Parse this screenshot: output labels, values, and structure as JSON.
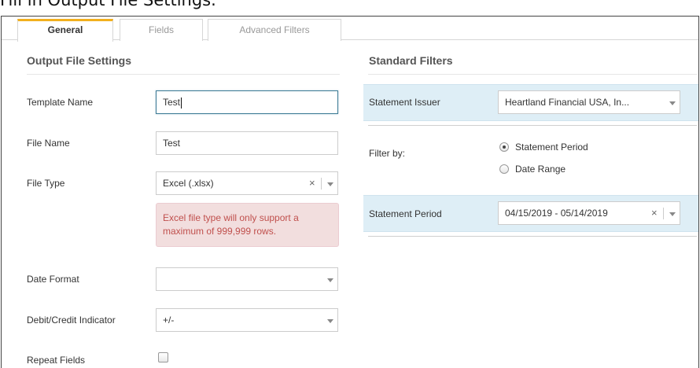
{
  "caption": "Fill in Output File Settings.",
  "tabs": {
    "general": "General",
    "fields": "Fields",
    "advanced_filters": "Advanced Filters"
  },
  "output_settings": {
    "title": "Output File Settings",
    "template_name": {
      "label": "Template Name",
      "value": "Test"
    },
    "file_name": {
      "label": "File Name",
      "value": "Test"
    },
    "file_type": {
      "label": "File Type",
      "value": "Excel (.xlsx)"
    },
    "file_type_warning": "Excel file type will only support a maximum of 999,999 rows.",
    "date_format": {
      "label": "Date Format",
      "value": ""
    },
    "debit_credit": {
      "label": "Debit/Credit Indicator",
      "value": "+/-"
    },
    "repeat_fields": {
      "label": "Repeat Fields",
      "checked": false
    }
  },
  "standard_filters": {
    "title": "Standard Filters",
    "statement_issuer": {
      "label": "Statement Issuer",
      "value": "Heartland Financial USA, In..."
    },
    "filter_by": {
      "label": "Filter by:",
      "options": [
        "Statement Period",
        "Date Range"
      ],
      "selected": "Statement Period"
    },
    "statement_period": {
      "label": "Statement Period",
      "value": "04/15/2019 - 05/14/2019"
    }
  },
  "icons": {
    "clear": "×",
    "dropdown": "chevron-down-icon"
  },
  "colors": {
    "active_tab_accent": "#f2b01e",
    "filter_band": "#deeef6",
    "warning_text": "#c0504d",
    "warning_bg": "#f2dede"
  }
}
